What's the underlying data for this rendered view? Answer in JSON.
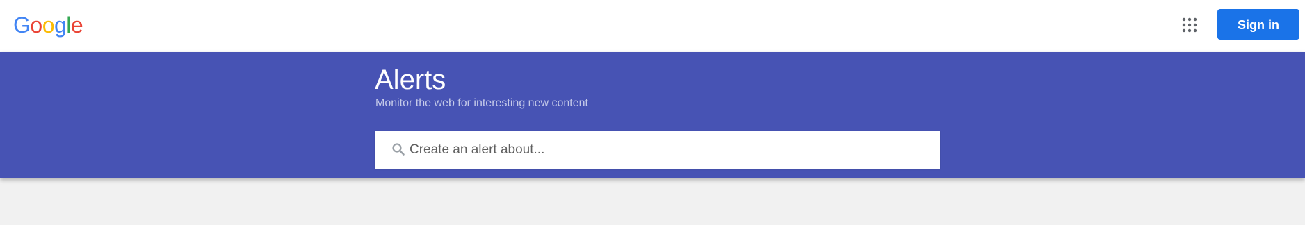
{
  "header": {
    "logo_letters": [
      {
        "char": "G",
        "color": "#4285f4"
      },
      {
        "char": "o",
        "color": "#ea4335"
      },
      {
        "char": "o",
        "color": "#fbbc05"
      },
      {
        "char": "g",
        "color": "#4285f4"
      },
      {
        "char": "l",
        "color": "#34a853"
      },
      {
        "char": "e",
        "color": "#ea4335"
      }
    ],
    "apps_icon": "apps-grid-icon",
    "sign_in_label": "Sign in",
    "sign_in_color": "#1a73e8"
  },
  "banner": {
    "title": "Alerts",
    "subtitle": "Monitor the web for interesting new content",
    "background": "#4753b4"
  },
  "search": {
    "icon": "search-icon",
    "placeholder": "Create an alert about...",
    "value": ""
  }
}
